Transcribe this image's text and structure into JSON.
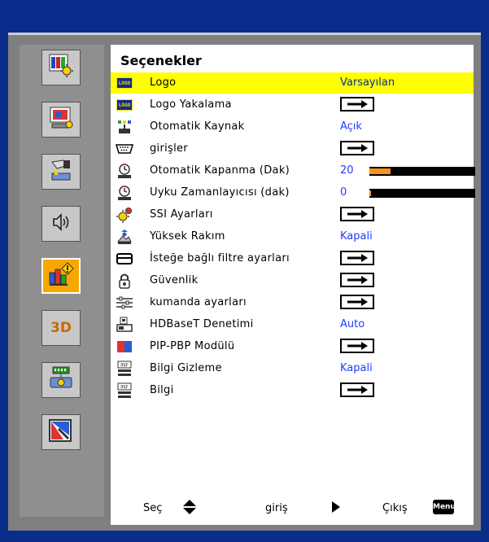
{
  "menu": {
    "title": "Seçenekler",
    "items": [
      {
        "label": "Logo",
        "value": "Varsayılan",
        "icon": "logo-icon",
        "kind": "value"
      },
      {
        "label": "Logo Yakalama",
        "icon": "logo-capture-icon",
        "kind": "arrow"
      },
      {
        "label": "Otomatik Kaynak",
        "value": "Açık",
        "icon": "auto-source-icon",
        "kind": "value"
      },
      {
        "label": "girişler",
        "icon": "input-icon",
        "kind": "arrow"
      },
      {
        "label": "Otomatik Kapanma (Dak)",
        "value": "20",
        "icon": "timer-icon",
        "kind": "slider",
        "level": 0.2
      },
      {
        "label": "Uyku Zamanlayıcısı (dak)",
        "value": "0",
        "icon": "sleep-timer-icon",
        "kind": "slider",
        "level": 0.0
      },
      {
        "label": "SSI Ayarları",
        "icon": "ssi-icon",
        "kind": "arrow"
      },
      {
        "label": "Yüksek Rakım",
        "value": "Kapali",
        "icon": "altitude-icon",
        "kind": "value"
      },
      {
        "label": "İsteğe bağlı filtre ayarları",
        "icon": "filter-icon",
        "kind": "arrow"
      },
      {
        "label": "Güvenlik",
        "icon": "security-icon",
        "kind": "arrow"
      },
      {
        "label": "kumanda ayarları",
        "icon": "remote-icon",
        "kind": "arrow"
      },
      {
        "label": "HDBaseT Denetimi",
        "value": "Auto",
        "icon": "hdbaset-icon",
        "kind": "value"
      },
      {
        "label": "PIP-PBP Modülü",
        "icon": "pip-icon",
        "kind": "arrow"
      },
      {
        "label": "Bilgi Gizleme",
        "value": "Kapali",
        "icon": "info-hide-icon",
        "kind": "value"
      },
      {
        "label": "Bilgi",
        "icon": "info-icon",
        "kind": "arrow"
      }
    ]
  },
  "sidebar": {
    "items": [
      {
        "name": "image-settings",
        "icon": "image-settings-icon"
      },
      {
        "name": "display",
        "icon": "display-icon"
      },
      {
        "name": "setup",
        "icon": "setup-icon"
      },
      {
        "name": "audio",
        "icon": "audio-icon"
      },
      {
        "name": "options",
        "icon": "options-icon",
        "active": true
      },
      {
        "name": "3d",
        "icon": "3d-icon",
        "label": "3D"
      },
      {
        "name": "lan",
        "icon": "lan-icon"
      },
      {
        "name": "advanced",
        "icon": "advanced-icon"
      }
    ]
  },
  "footer": {
    "select_label": "Seç",
    "enter_label": "giriş",
    "exit_label": "Çıkış",
    "menu_badge": "Menu"
  },
  "colors": {
    "background": "#0a2d8c",
    "selected_row": "#ffff00",
    "value_text": "#1f3aff",
    "active_tab": "#f7a700",
    "slider_fill": "#f7921e"
  }
}
